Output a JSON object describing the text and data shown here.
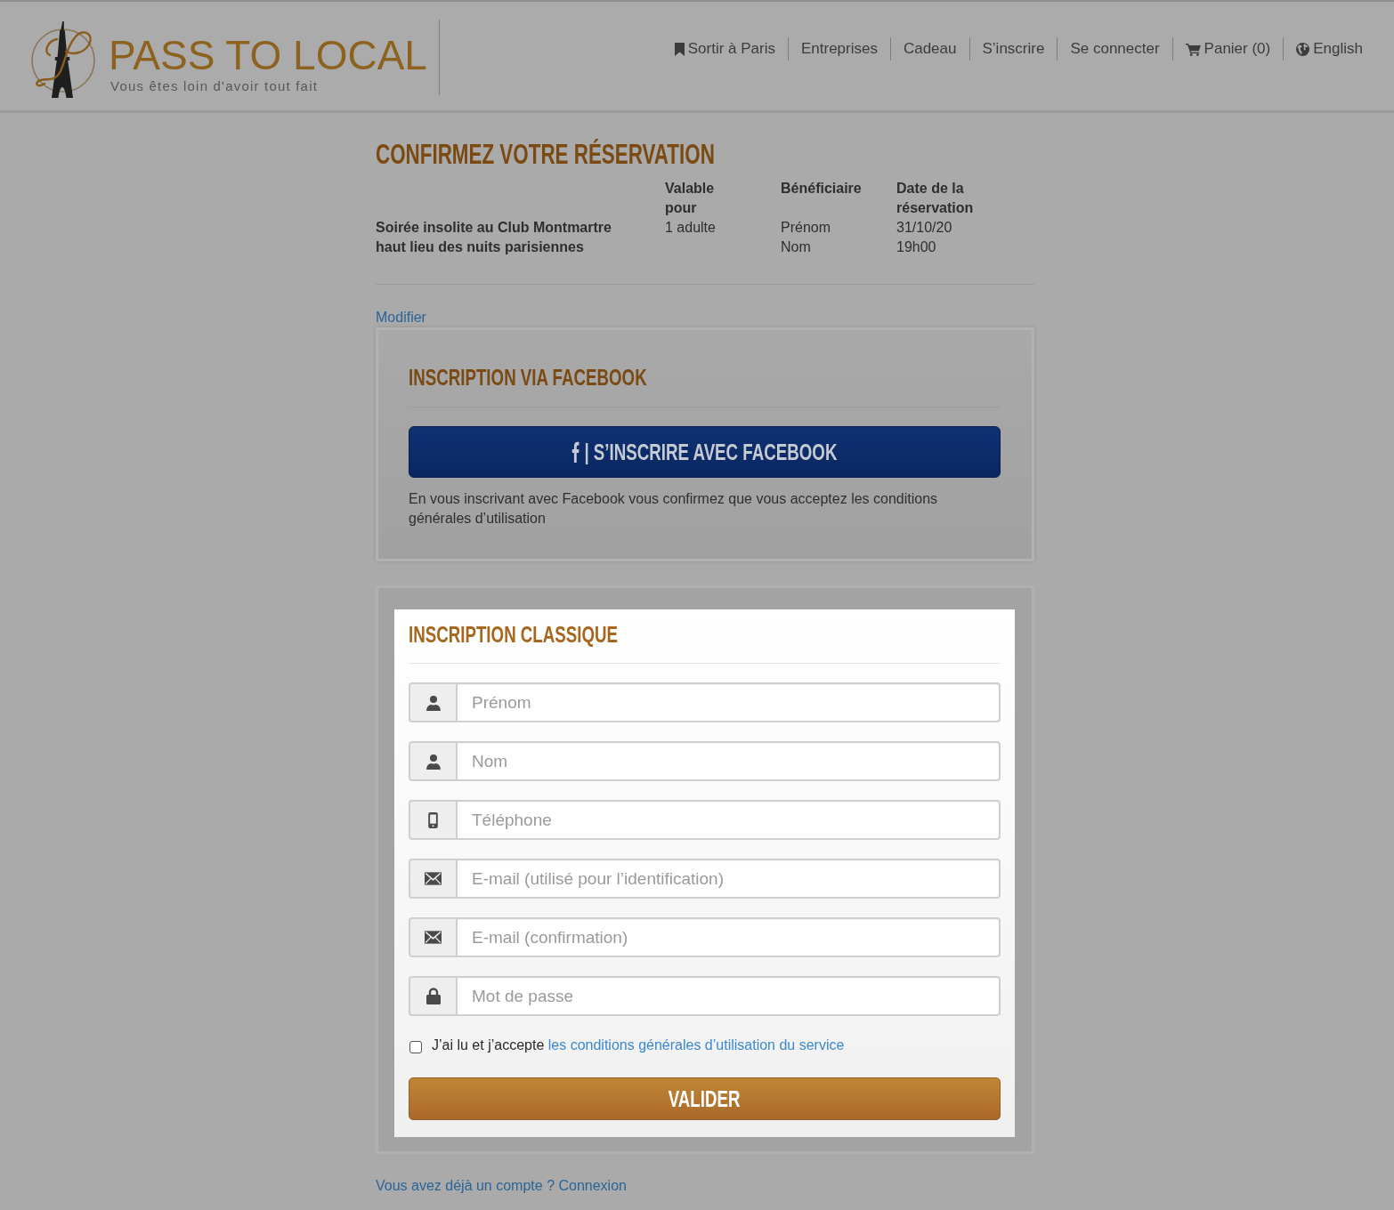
{
  "header": {
    "logo": {
      "title": "PASS TO LOCAL",
      "tagline": "Vous êtes loin d'avoir tout fait"
    },
    "nav": [
      {
        "label": "Sortir à Paris",
        "kind": "section"
      },
      {
        "label": "Entreprises",
        "kind": "page"
      },
      {
        "label": "Cadeau",
        "kind": "page"
      },
      {
        "label": "S’inscrire",
        "kind": "page"
      },
      {
        "label": "Se connecter",
        "kind": "page"
      },
      {
        "label": "Panier (0)",
        "kind": "basket"
      },
      {
        "label": "English",
        "kind": "language"
      }
    ]
  },
  "reservation": {
    "title": "CONFIRMEZ VOTRE RÉSERVATION",
    "table": {
      "headers": [
        "Valable pour",
        "Bénéficiaire",
        "Date de la réservation"
      ],
      "rows": [
        {
          "item": [
            "Soirée insolite au Club Montmartre",
            "haut lieu des nuits parisiennes"
          ],
          "cells": [
            [
              "1 adulte"
            ],
            [
              "Prénom",
              "Nom"
            ],
            [
              "31/10/20",
              "19h00"
            ]
          ]
        }
      ]
    },
    "modify_link": "Modifier"
  },
  "facebook_signup": {
    "title": "INSCRIPTION VIA FACEBOOK",
    "button": "| S’INSCRIRE AVEC FACEBOOK",
    "note": "En vous inscrivant avec Facebook vous confirmez que vous acceptez les conditions générales d’utilisation"
  },
  "classic_signup": {
    "title": "INSCRIPTION CLASSIQUE",
    "fields": [
      {
        "kind": "name",
        "placeholder": "Prénom"
      },
      {
        "kind": "name",
        "placeholder": "Nom"
      },
      {
        "kind": "phone",
        "placeholder": "Téléphone"
      },
      {
        "kind": "email",
        "placeholder": "E-mail (utilisé pour l’identification)"
      },
      {
        "kind": "email",
        "placeholder": "E-mail (confirmation)"
      },
      {
        "kind": "password",
        "placeholder": "Mot de passe"
      }
    ],
    "terms": {
      "checked": false,
      "text": "J’ai lu et j’accepte",
      "link": "les conditions générales d’utilisation du service"
    },
    "submit": "VALIDER"
  },
  "login_prompt": "Vous avez déjà un compte ? Connexion"
}
